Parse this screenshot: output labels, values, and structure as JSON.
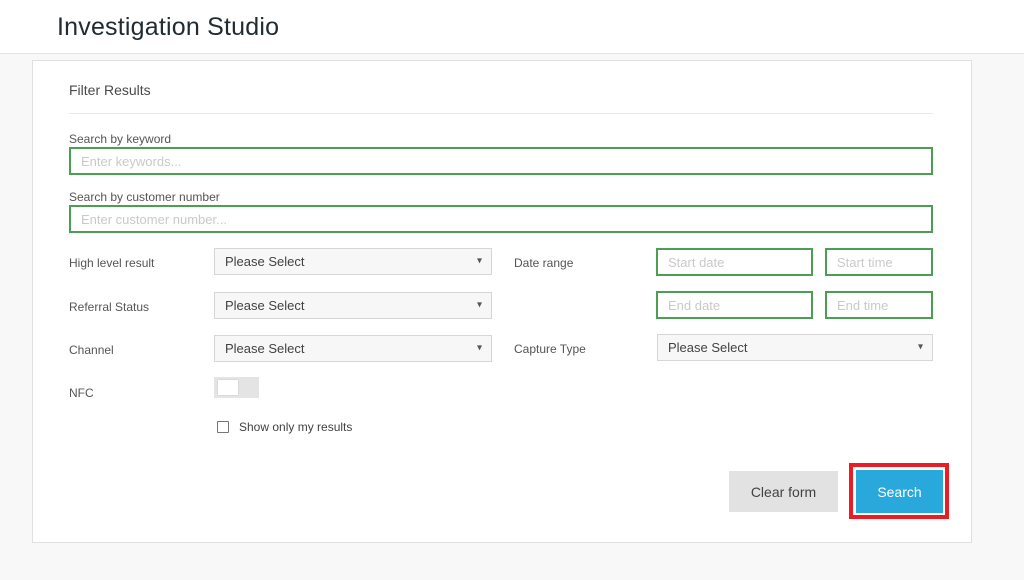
{
  "header": {
    "title": "Investigation Studio"
  },
  "panel": {
    "title": "Filter Results",
    "keyword": {
      "label": "Search by keyword",
      "placeholder": "Enter keywords...",
      "value": ""
    },
    "customer": {
      "label": "Search by customer number",
      "placeholder": "Enter customer number...",
      "value": ""
    },
    "high_level_result": {
      "label": "High level result",
      "value": "Please Select"
    },
    "referral_status": {
      "label": "Referral Status",
      "value": "Please Select"
    },
    "channel": {
      "label": "Channel",
      "value": "Please Select"
    },
    "capture_type": {
      "label": "Capture Type",
      "value": "Please Select"
    },
    "date_range": {
      "label": "Date range",
      "start_date_placeholder": "Start date",
      "start_time_placeholder": "Start time",
      "end_date_placeholder": "End date",
      "end_time_placeholder": "End time"
    },
    "nfc": {
      "label": "NFC",
      "state": "off"
    },
    "show_only_my_results": {
      "label": "Show only my results",
      "checked": false
    },
    "buttons": {
      "clear": "Clear form",
      "search": "Search"
    },
    "dropdown_caret_icon": "▾"
  },
  "colors": {
    "input_border_green": "#4c9e52",
    "search_button_blue": "#29a8dc",
    "annotation_red": "#ec1c24"
  }
}
